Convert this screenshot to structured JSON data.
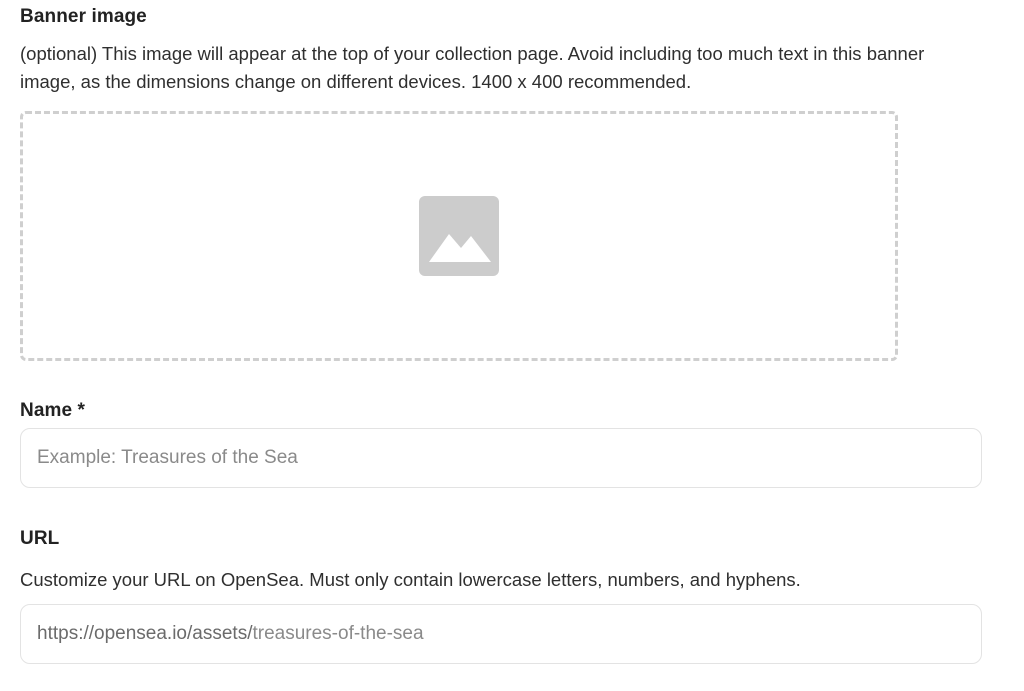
{
  "banner": {
    "label": "Banner image",
    "description": "(optional) This image will appear at the top of your collection page. Avoid including too much text in this banner image, as the dimensions change on different devices. 1400 x 400 recommended.",
    "icon": "image-placeholder-icon"
  },
  "name": {
    "label": "Name *",
    "placeholder": "Example: Treasures of the Sea",
    "value": ""
  },
  "url": {
    "label": "URL",
    "description": "Customize your URL on OpenSea. Must only contain lowercase letters, numbers, and hyphens.",
    "prefix": "https://opensea.io/assets/",
    "placeholder": "treasures-of-the-sea",
    "value": ""
  },
  "colors": {
    "icon_gray": "#cccccc",
    "border": "#e3e3e3",
    "dash": "#cfcfcf"
  }
}
